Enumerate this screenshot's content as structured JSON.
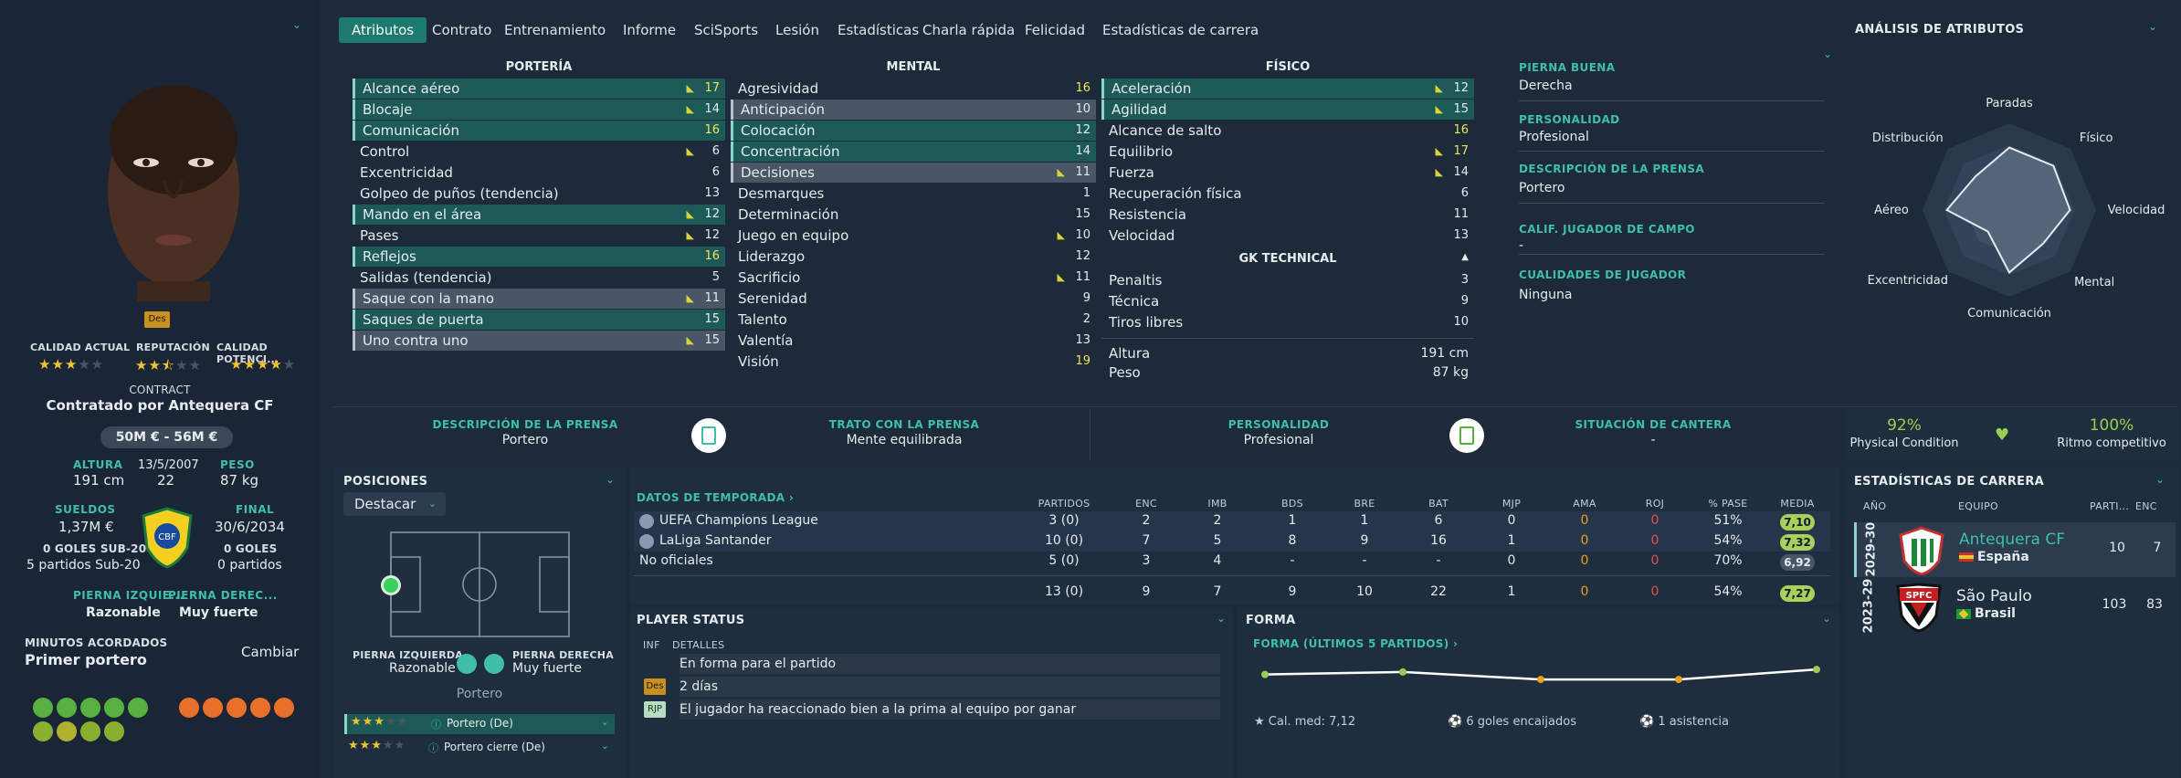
{
  "left": {
    "role_badge": "Des",
    "ratings": [
      {
        "label": "CALIDAD ACTUAL",
        "stars": 3
      },
      {
        "label": "REPUTACIÓN",
        "stars": 2.5
      },
      {
        "label": "CALIDAD POTENCI...",
        "stars": 4
      }
    ],
    "contract_label": "CONTRACT",
    "contract_value": "Contratado por Antequera CF",
    "value_range": "50M € - 56M €",
    "height_label": "ALTURA",
    "height": "191 cm",
    "dob": "13/5/2007",
    "age": "22",
    "weight_label": "PESO",
    "weight": "87 kg",
    "wage_label": "SUELDOS",
    "wage": "1,37M €",
    "u20_goals": "0 GOLES SUB-20",
    "u20_matches": "5 partidos Sub-20",
    "end_label": "FINAL",
    "end_date": "30/6/2034",
    "goals": "0 GOLES",
    "matches": "0 partidos",
    "left_foot_label": "PIERNA IZQUIE...",
    "left_foot": "Razonable",
    "right_foot_label": "PIERNA DEREC...",
    "right_foot": "Muy fuerte",
    "min_label": "MINUTOS ACORDADOS",
    "min_value": "Primer portero",
    "change": "Cambiar"
  },
  "tabs": [
    "Atributos",
    "Contrato",
    "Entrenamiento",
    "Informe",
    "SciSports",
    "Lesión",
    "Estadísticas",
    "Charla rápida",
    "Felicidad",
    "Estadísticas de carrera"
  ],
  "attrs": {
    "gk_title": "PORTERÍA",
    "gk": [
      {
        "n": "Alcance aéreo",
        "v": "17"
      },
      {
        "n": "Blocaje",
        "v": "14"
      },
      {
        "n": "Comunicación",
        "v": "16"
      },
      {
        "n": "Control",
        "v": "6"
      },
      {
        "n": "Excentricidad",
        "v": "6"
      },
      {
        "n": "Golpeo de puños (tendencia)",
        "v": "13"
      },
      {
        "n": "Mando en el área",
        "v": "12"
      },
      {
        "n": "Pases",
        "v": "12"
      },
      {
        "n": "Reflejos",
        "v": "16"
      },
      {
        "n": "Salidas (tendencia)",
        "v": "5"
      },
      {
        "n": "Saque con la mano",
        "v": "11"
      },
      {
        "n": "Saques de puerta",
        "v": "15"
      },
      {
        "n": "Uno contra uno",
        "v": "15"
      }
    ],
    "mental_title": "MENTAL",
    "mental": [
      {
        "n": "Agresividad",
        "v": "16"
      },
      {
        "n": "Anticipación",
        "v": "10"
      },
      {
        "n": "Colocación",
        "v": "12"
      },
      {
        "n": "Concentración",
        "v": "14"
      },
      {
        "n": "Decisiones",
        "v": "11"
      },
      {
        "n": "Desmarques",
        "v": "1"
      },
      {
        "n": "Determinación",
        "v": "15"
      },
      {
        "n": "Juego en equipo",
        "v": "10"
      },
      {
        "n": "Liderazgo",
        "v": "12"
      },
      {
        "n": "Sacrificio",
        "v": "11"
      },
      {
        "n": "Serenidad",
        "v": "9"
      },
      {
        "n": "Talento",
        "v": "2"
      },
      {
        "n": "Valentía",
        "v": "13"
      },
      {
        "n": "Visión",
        "v": "19"
      }
    ],
    "phys_title": "FÍSICO",
    "phys": [
      {
        "n": "Aceleración",
        "v": "12"
      },
      {
        "n": "Agilidad",
        "v": "15"
      },
      {
        "n": "Alcance de salto",
        "v": "16"
      },
      {
        "n": "Equilibrio",
        "v": "17"
      },
      {
        "n": "Fuerza",
        "v": "14"
      },
      {
        "n": "Recuperación física",
        "v": "6"
      },
      {
        "n": "Resistencia",
        "v": "11"
      },
      {
        "n": "Velocidad",
        "v": "13"
      }
    ],
    "gkt_title": "GK TECHNICAL",
    "gkt": [
      {
        "n": "Penaltis",
        "v": "3"
      },
      {
        "n": "Técnica",
        "v": "9"
      },
      {
        "n": "Tiros libres",
        "v": "10"
      }
    ],
    "height_label": "Altura",
    "height": "191 cm",
    "weight_label": "Peso",
    "weight": "87 kg"
  },
  "info": {
    "foot_label": "PIERNA BUENA",
    "foot": "Derecha",
    "pers_label": "PERSONALIDAD",
    "pers": "Profesional",
    "press_label": "DESCRIPCIÓN DE LA PRENSA",
    "press": "Portero",
    "field_label": "CALIF. JUGADOR DE CAMPO",
    "field": "-",
    "qual_label": "CUALIDADES DE JUGADOR",
    "qual": "Ninguna"
  },
  "radar": {
    "title": "ANÁLISIS DE ATRIBUTOS",
    "labels": [
      "Paradas",
      "Físico",
      "Velocidad",
      "Mental",
      "Comunicación",
      "Excentricidad",
      "Aéreo",
      "Distribución"
    ],
    "values": [
      0.72,
      0.72,
      0.7,
      0.55,
      0.72,
      0.35,
      0.72,
      0.55
    ]
  },
  "band": {
    "press_label": "DESCRIPCIÓN DE LA PRENSA",
    "press": "Portero",
    "trato_label": "TRATO CON LA PRENSA",
    "trato": "Mente equilibrada",
    "pers_label": "PERSONALIDAD",
    "pers": "Profesional",
    "cantera_label": "SITUACIÓN DE CANTERA",
    "cantera": "-",
    "cond_pct": "92%",
    "cond_label": "Physical Condition",
    "ritmo_pct": "100%",
    "ritmo_label": "Ritmo competitivo"
  },
  "positions": {
    "title": "POSICIONES",
    "dropdown": "Destacar",
    "lf_label": "PIERNA IZQUIERDA",
    "lf": "Razonable",
    "rf_label": "PIERNA DERECHA",
    "rf": "Muy fuerte",
    "pos_name": "Portero",
    "roles": [
      {
        "n": "Portero (De)",
        "stars": 3
      },
      {
        "n": "Portero cierre (De)",
        "stars": 3
      }
    ]
  },
  "season": {
    "title": "DATOS DE TEMPORADA",
    "headers": [
      "PARTIDOS",
      "ENC",
      "IMB",
      "BDS",
      "BRE",
      "BAT",
      "MJP",
      "AMA",
      "ROJ",
      "% PASE",
      "MEDIA"
    ],
    "rows": [
      {
        "comp": "UEFA Champions League",
        "vals": [
          "3 (0)",
          "2",
          "2",
          "1",
          "1",
          "6",
          "0",
          "0",
          "0",
          "51%"
        ],
        "media": "7,10",
        "good": true
      },
      {
        "comp": "LaLiga Santander",
        "vals": [
          "10 (0)",
          "7",
          "5",
          "8",
          "9",
          "16",
          "1",
          "0",
          "0",
          "54%"
        ],
        "media": "7,32",
        "good": true
      },
      {
        "comp": "No oficiales",
        "vals": [
          "5 (0)",
          "3",
          "4",
          "-",
          "-",
          "-",
          "0",
          "0",
          "0",
          "70%"
        ],
        "media": "6,92",
        "good": false
      }
    ],
    "total": {
      "vals": [
        "13 (0)",
        "9",
        "7",
        "9",
        "10",
        "22",
        "1",
        "0",
        "0",
        "54%"
      ],
      "media": "7,27"
    }
  },
  "status": {
    "title": "PLAYER STATUS",
    "col1": "INF",
    "col2": "DETALLES",
    "rows": [
      {
        "badge": "",
        "text": "En forma para el partido"
      },
      {
        "badge": "Des",
        "text": "2 días"
      },
      {
        "badge": "RJP",
        "text": "El jugador ha reaccionado bien a la prima al equipo por ganar"
      }
    ]
  },
  "form": {
    "title": "FORMA",
    "sub": "FORMA (ÚLTIMOS 5 PARTIDOS)",
    "values": [
      7.1,
      7.2,
      6.9,
      6.9,
      7.3
    ],
    "avg": "Cal. med: 7,12",
    "conceded": "6 goles encaijados",
    "assists": "1 asistencia"
  },
  "career": {
    "title": "ESTADÍSTICAS DE CARRERA",
    "headers": [
      "AÑO",
      "EQUIPO",
      "PARTI...",
      "ENC"
    ],
    "rows": [
      {
        "year": "2029-30",
        "team": "Antequera CF",
        "country": "España",
        "matches": "10",
        "enc": "7",
        "hl": true
      },
      {
        "year": "2023-29",
        "team": "São Paulo",
        "country": "Brasil",
        "matches": "103",
        "enc": "83",
        "hl": false
      }
    ]
  }
}
